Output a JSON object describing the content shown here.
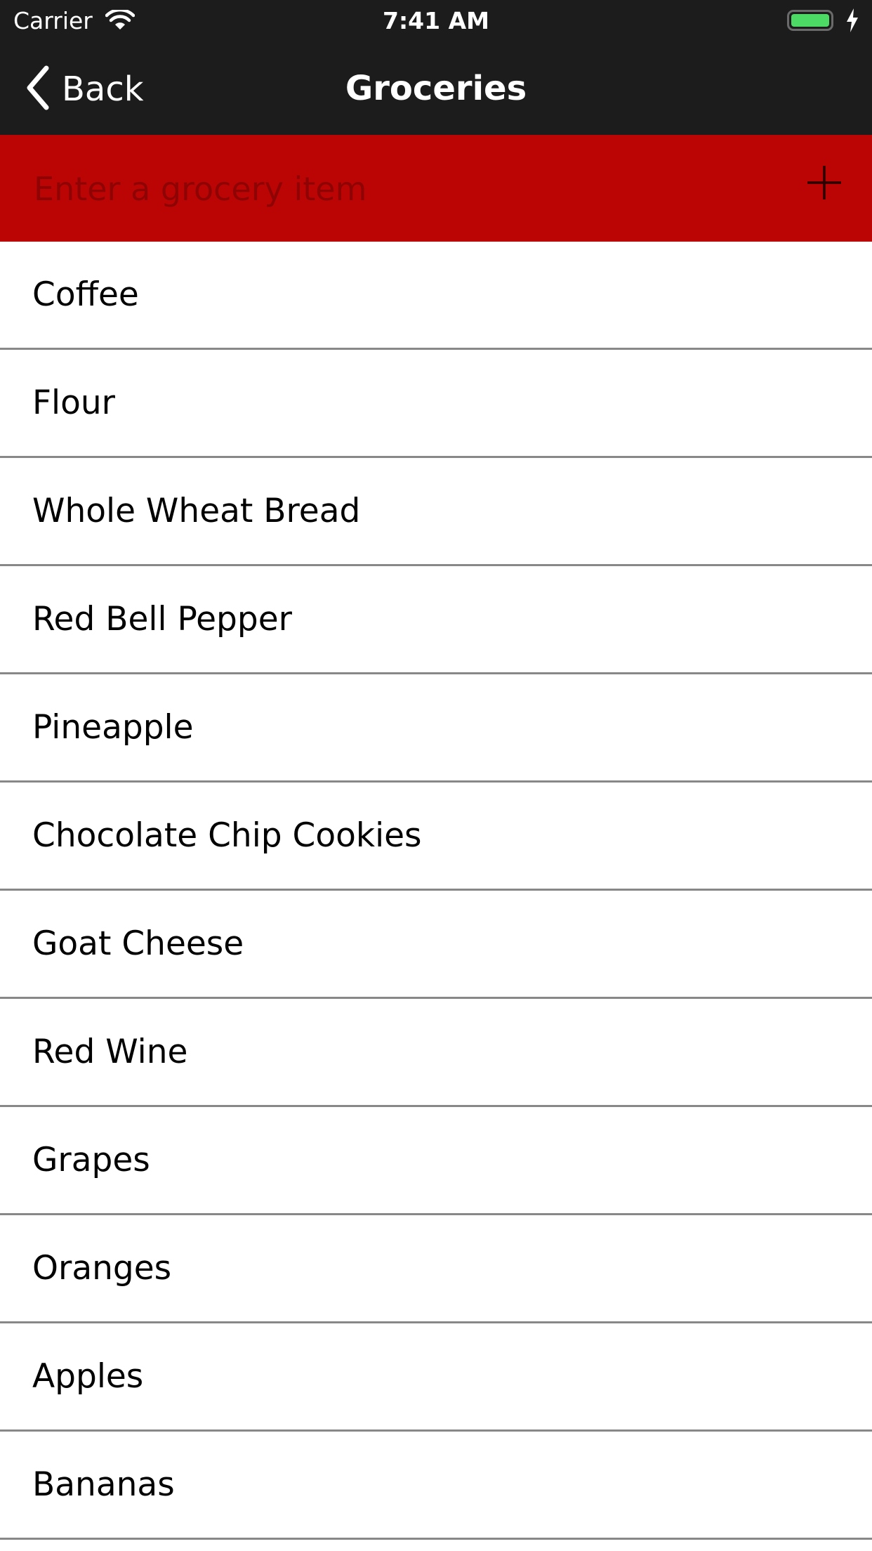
{
  "status_bar": {
    "carrier": "Carrier",
    "time": "7:41 AM",
    "battery_color": "#4cd964"
  },
  "nav_bar": {
    "back_label": "Back",
    "title": "Groceries",
    "background": "#1c1c1c"
  },
  "add_bar": {
    "placeholder": "Enter a grocery item",
    "value": "",
    "background": "#bb0404",
    "add_icon": "plus-icon"
  },
  "items": [
    {
      "label": "Coffee"
    },
    {
      "label": "Flour"
    },
    {
      "label": "Whole Wheat Bread"
    },
    {
      "label": "Red Bell Pepper"
    },
    {
      "label": "Pineapple"
    },
    {
      "label": "Chocolate Chip Cookies"
    },
    {
      "label": "Goat Cheese"
    },
    {
      "label": "Red Wine"
    },
    {
      "label": "Grapes"
    },
    {
      "label": "Oranges"
    },
    {
      "label": "Apples"
    },
    {
      "label": "Bananas"
    }
  ]
}
